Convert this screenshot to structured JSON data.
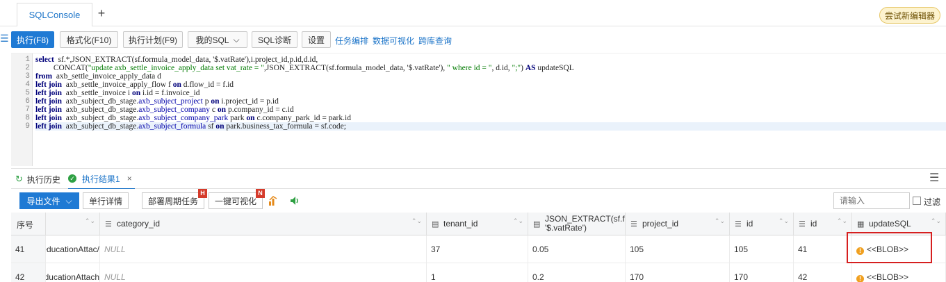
{
  "tabs": {
    "active_tab": "SQLConsole",
    "add_symbol": "+",
    "try_new_editor": "尝试新编辑器"
  },
  "toolbar": {
    "menu_symbol": "☰",
    "execute": "执行(F8)",
    "format": "格式化(F10)",
    "plan": "执行计划(F9)",
    "my_sql": "我的SQL",
    "my_sql_chevron": "⌵",
    "diagnose": "SQL诊断",
    "settings": "设置",
    "task_schedule": "任务编排",
    "data_viz": "数据可视化",
    "cross_db": "跨库查询"
  },
  "editor": {
    "line_numbers": [
      "1",
      "2",
      "3",
      "4",
      "5",
      "6",
      "7",
      "8",
      "9"
    ],
    "lines": [
      [
        [
          "kw",
          "select"
        ],
        [
          "",
          "  sf.*,JSON_EXTRACT(sf.formula_model_data, '$.vatRate'),i.project_id,p.id,d.id,"
        ]
      ],
      [
        [
          "",
          "         CONCAT("
        ],
        [
          "str",
          "\"update axb_settle_invoice_apply_data set vat_rate = \""
        ],
        [
          "",
          ",JSON_EXTRACT(sf.formula_model_data, '$.vatRate'), "
        ],
        [
          "str",
          "\" where id = \""
        ],
        [
          "",
          ", d.id, "
        ],
        [
          "str",
          "\";\""
        ],
        [
          "",
          ") "
        ],
        [
          "kw",
          "AS"
        ],
        [
          "",
          " updateSQL"
        ]
      ],
      [
        [
          "kw",
          "from"
        ],
        [
          "",
          "  axb_settle_invoice_apply_data d"
        ]
      ],
      [
        [
          "kw",
          "left join"
        ],
        [
          "",
          "  axb_settle_invoice_apply_flow f "
        ],
        [
          "kw",
          "on"
        ],
        [
          "",
          " d.flow_id = f.id"
        ]
      ],
      [
        [
          "kw",
          "left join"
        ],
        [
          "",
          "  axb_settle_invoice i "
        ],
        [
          "kw",
          "on"
        ],
        [
          "",
          " i.id = f.invoice_id"
        ]
      ],
      [
        [
          "kw",
          "left join"
        ],
        [
          "",
          "  axb_subject_db_stage."
        ],
        [
          "obj",
          "axb_subject_project"
        ],
        [
          "",
          " p "
        ],
        [
          "kw",
          "on"
        ],
        [
          "",
          " i.project_id = p.id"
        ]
      ],
      [
        [
          "kw",
          "left join"
        ],
        [
          "",
          "  axb_subject_db_stage."
        ],
        [
          "obj",
          "axb_subject_company"
        ],
        [
          "",
          " c "
        ],
        [
          "kw",
          "on"
        ],
        [
          "",
          " p.company_id = c.id"
        ]
      ],
      [
        [
          "kw",
          "left join"
        ],
        [
          "",
          "  axb_subject_db_stage."
        ],
        [
          "obj",
          "axb_subject_company_park"
        ],
        [
          "",
          " park "
        ],
        [
          "kw",
          "on"
        ],
        [
          "",
          " c.company_park_id = park.id"
        ]
      ],
      [
        [
          "kw",
          "left join"
        ],
        [
          "",
          "  axb_subject_db_stage."
        ],
        [
          "obj",
          "axb_subject_formula"
        ],
        [
          "",
          " sf "
        ],
        [
          "kw",
          "on"
        ],
        [
          "",
          " park.business_tax_formula = sf.code;"
        ]
      ]
    ]
  },
  "results_tabs": {
    "history": "执行历史",
    "history_icon": "↻",
    "result": "执行结果1",
    "result_check": "✓",
    "close": "×",
    "menu": "☰"
  },
  "results_toolbar": {
    "export": "导出文件",
    "export_chevron": "⌵",
    "detail": "单行详情",
    "deploy": "部署周期任务",
    "deploy_badge": "H",
    "one_click_viz": "一键可视化",
    "viz_badge": "N",
    "search_placeholder": "请输入",
    "filter_label": "过滤"
  },
  "grid": {
    "columns": [
      "序号",
      "",
      "category_id",
      "tenant_id",
      "JSON_EXTRACT(sf.f",
      "'$.vatRate')",
      "project_id",
      "id",
      "id",
      "updateSQL"
    ],
    "column_icon": "☰",
    "sort_symbol": "⌃⌄",
    "rows": [
      {
        "num": "41",
        "col1": "/educationAttac",
        "category_id": "NULL",
        "tenant_id": "37",
        "json": "0.05",
        "project_id": "105",
        "id1": "105",
        "id2": "41",
        "warn": "!",
        "update": "<<BLOB>>"
      },
      {
        "num": "42",
        "col1": "educationAttach",
        "category_id": "NULL",
        "tenant_id": "1",
        "json": "0.2",
        "project_id": "170",
        "id1": "170",
        "id2": "42",
        "warn": "!",
        "update": "<<BLOB>>"
      }
    ]
  }
}
